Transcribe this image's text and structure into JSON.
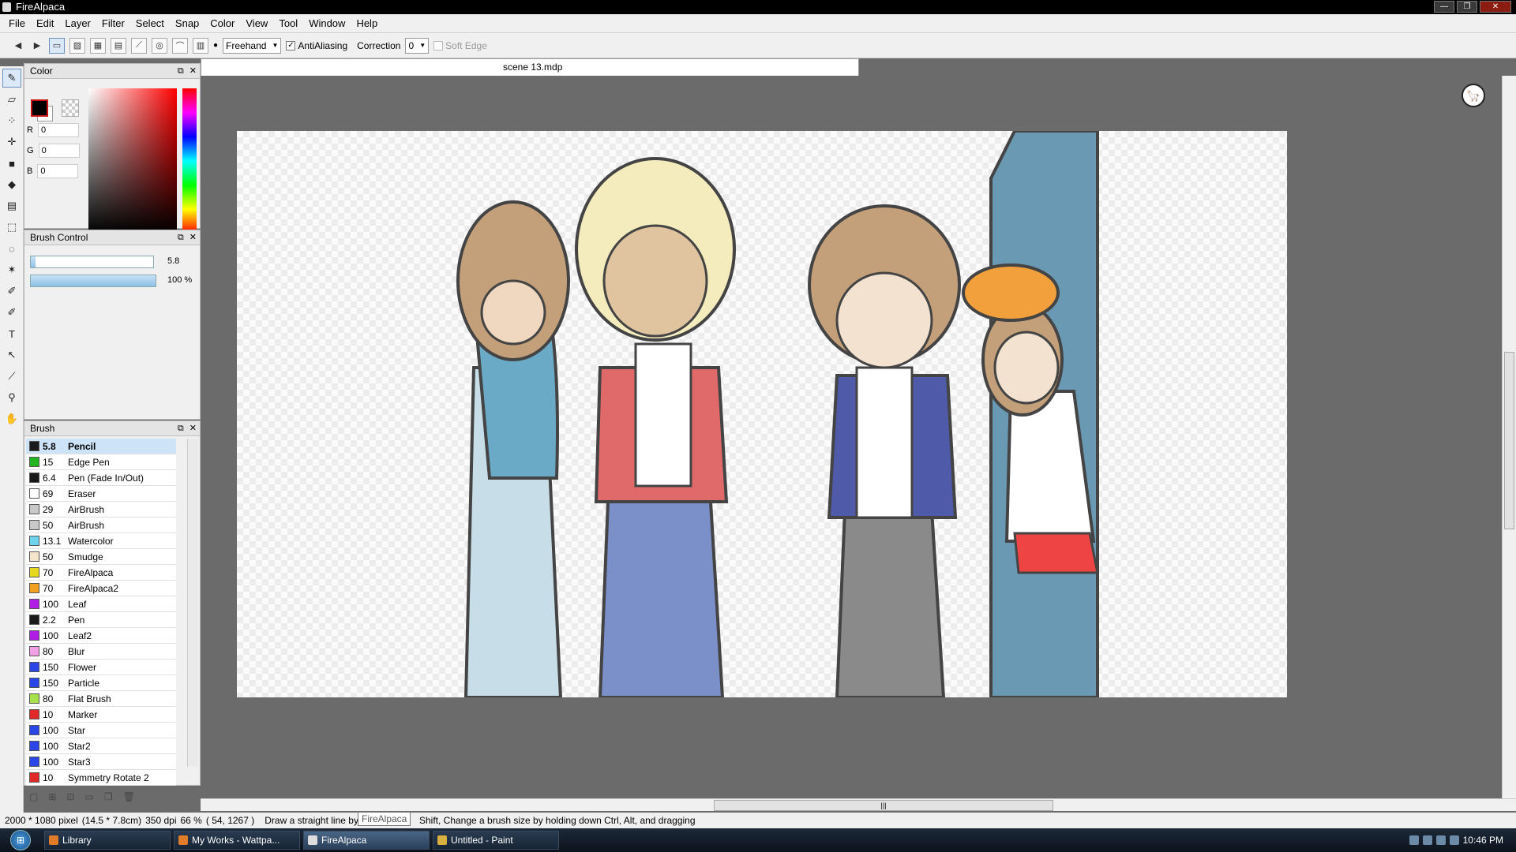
{
  "window": {
    "title": "FireAlpaca",
    "controls": [
      "—",
      "❐",
      "✕"
    ]
  },
  "menu": [
    "File",
    "Edit",
    "Layer",
    "Filter",
    "Select",
    "Snap",
    "Color",
    "View",
    "Tool",
    "Window",
    "Help"
  ],
  "toolbar": {
    "brush_mode": "Freehand",
    "antialiasing_label": "AntiAliasing",
    "antialiasing_checked": "✓",
    "correction_label": "Correction",
    "correction_value": "0",
    "soft_edge_label": "Soft Edge"
  },
  "color_panel": {
    "title": "Color",
    "r_label": "R",
    "g_label": "G",
    "b_label": "B",
    "r": "0",
    "g": "0",
    "b": "0"
  },
  "brush_control": {
    "title": "Brush Control",
    "size": "5.8",
    "opacity": "100 %",
    "size_fraction": 0.04,
    "opacity_fraction": 1.0
  },
  "brush_panel": {
    "title": "Brush",
    "items": [
      {
        "size": "5.8",
        "name": "Pencil",
        "color": "#1a1a1a",
        "selected": true
      },
      {
        "size": "15",
        "name": "Edge Pen",
        "color": "#22b422"
      },
      {
        "size": "6.4",
        "name": "Pen (Fade In/Out)",
        "color": "#1a1a1a"
      },
      {
        "size": "69",
        "name": "Eraser",
        "color": "#ffffff"
      },
      {
        "size": "29",
        "name": "AirBrush",
        "color": "#c8c8c8"
      },
      {
        "size": "50",
        "name": "AirBrush",
        "color": "#c8c8c8"
      },
      {
        "size": "13.1",
        "name": "Watercolor",
        "color": "#6fd2ec"
      },
      {
        "size": "50",
        "name": "Smudge",
        "color": "#f4e4cc"
      },
      {
        "size": "70",
        "name": "FireAlpaca",
        "color": "#e6d81e"
      },
      {
        "size": "70",
        "name": "FireAlpaca2",
        "color": "#f0a01e"
      },
      {
        "size": "100",
        "name": "Leaf",
        "color": "#b01ee6"
      },
      {
        "size": "2.2",
        "name": "Pen",
        "color": "#1a1a1a"
      },
      {
        "size": "100",
        "name": "Leaf2",
        "color": "#b01ee6"
      },
      {
        "size": "80",
        "name": "Blur",
        "color": "#f2a0e6"
      },
      {
        "size": "150",
        "name": "Flower",
        "color": "#2a46e6"
      },
      {
        "size": "150",
        "name": "Particle",
        "color": "#2a46e6"
      },
      {
        "size": "80",
        "name": "Flat Brush",
        "color": "#a6e04a"
      },
      {
        "size": "10",
        "name": "Marker",
        "color": "#e02a2a"
      },
      {
        "size": "100",
        "name": "Star",
        "color": "#2a46e6"
      },
      {
        "size": "100",
        "name": "Star2",
        "color": "#2a46e6"
      },
      {
        "size": "100",
        "name": "Star3",
        "color": "#2a46e6"
      },
      {
        "size": "10",
        "name": "Symmetry Rotate 2",
        "color": "#e02a2a"
      }
    ]
  },
  "document": {
    "tab_title": "scene 13.mdp"
  },
  "status": {
    "size": "2000 * 1080 pixel",
    "physical": "(14.5 * 7.8cm)",
    "dpi": "350 dpi",
    "zoom": "66 %",
    "coords": "( 54, 1267 )",
    "hint": "Draw a straight line by h",
    "hint2": "Shift, Change a brush size by holding down Ctrl, Alt, and dragging",
    "tooltip": "FireAlpaca"
  },
  "taskbar": {
    "items": [
      {
        "label": "Library",
        "active": false
      },
      {
        "label": "My Works - Wattpa...",
        "active": false
      },
      {
        "label": "FireAlpaca",
        "active": true
      },
      {
        "label": "Untitled - Paint",
        "active": false
      }
    ],
    "clock": "10:46 PM"
  }
}
